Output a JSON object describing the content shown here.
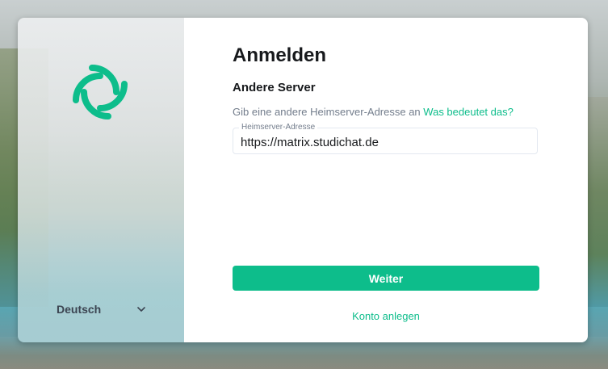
{
  "auth": {
    "title": "Anmelden",
    "subtitle": "Andere Server",
    "description": "Gib eine andere Heimserver-Adresse an",
    "help_link": "Was bedeutet das?",
    "field_label": "Heimserver-Adresse",
    "field_value": "https://matrix.studichat.de",
    "submit_label": "Weiter",
    "create_account_label": "Konto anlegen"
  },
  "sidebar": {
    "logo_icon": "element-logo-icon",
    "language": "Deutsch",
    "language_icon": "chevron-down-icon"
  },
  "colors": {
    "accent": "#0dbd8b",
    "text": "#17191c",
    "muted": "#737d8c"
  }
}
